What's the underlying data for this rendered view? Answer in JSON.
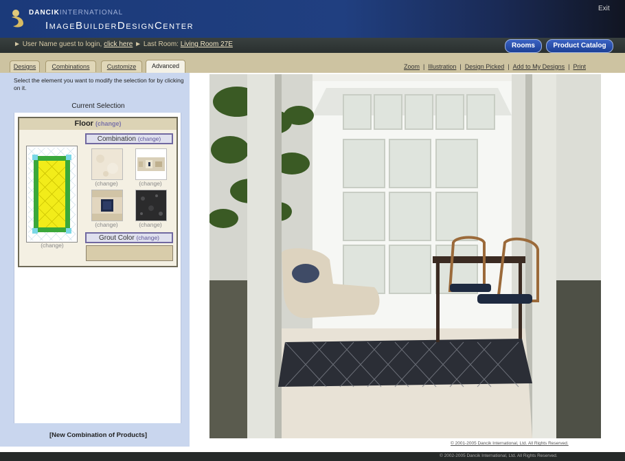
{
  "header": {
    "brand_part1": "DANCIK",
    "brand_part2": "INTERNATIONAL",
    "app_title": "ImageBuilderDesignCenter",
    "exit_label": "Exit"
  },
  "infobar": {
    "user_prefix": "User Name guest to login,",
    "login_link": "click here",
    "last_room_prefix": "Last Room:",
    "last_room_link": "Living Room 27E",
    "rooms_button": "Rooms",
    "catalog_button": "Product Catalog"
  },
  "tabs": {
    "designs": "Designs",
    "combinations": "Combinations",
    "customize": "Customize",
    "advanced": "Advanced"
  },
  "toplinks": {
    "zoom": "Zoom",
    "illustration": "Illustration",
    "design_picked": "Design Picked",
    "add_to_designs": "Add to My Designs",
    "print": "Print"
  },
  "panel": {
    "instructions": "Select the element you want to modify the selection for by clicking on it.",
    "current_selection": "Current Selection",
    "floor_label": "Floor",
    "floor_change": "(change)",
    "preview_change": "(change)",
    "combination_label": "Combination",
    "combination_change": "(change)",
    "swatch_changes": [
      "(change)",
      "(change)",
      "(change)",
      "(change)"
    ],
    "grout_label": "Grout Color",
    "grout_change": "(change)",
    "new_combination": "[New Combination of Products]"
  },
  "colors": {
    "header_blue": "#1b3a7a",
    "tab_tan": "#cdc3a1",
    "panel_blue": "#c9d6ee",
    "grout": "#d8ccaa",
    "preview_green": "#3aa83a",
    "preview_yellow": "#f2ec1a",
    "preview_cyan": "#7ad7e6"
  },
  "footer": {
    "copyright_photo": "© 2001-2005 Dancik International, Ltd. All Rights Reserved.",
    "copyright_app": "© 2002-2005 Dancik International, Ltd. All Rights Reserved."
  }
}
